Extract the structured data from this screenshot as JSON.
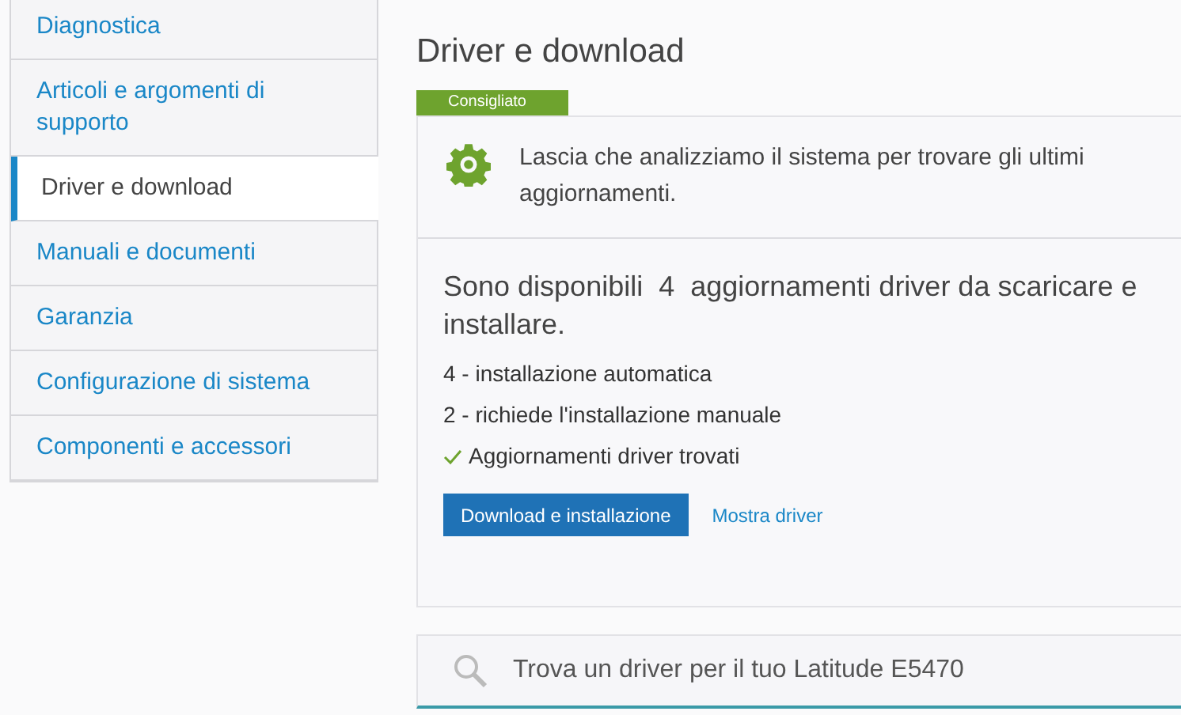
{
  "sidebar": {
    "items": [
      {
        "label": "Diagnostica",
        "selected": false
      },
      {
        "label": "Articoli e argomenti di supporto",
        "selected": false
      },
      {
        "label": "Driver e download",
        "selected": true
      },
      {
        "label": "Manuali e documenti",
        "selected": false
      },
      {
        "label": "Garanzia",
        "selected": false
      },
      {
        "label": "Configurazione di sistema",
        "selected": false
      },
      {
        "label": "Componenti e accessori",
        "selected": false
      }
    ]
  },
  "page_title": "Driver e download",
  "card": {
    "badge": "Consigliato",
    "intro": "Lascia che analizziamo il sistema per trovare gli ultimi aggiornamenti.",
    "heading": "Sono disponibili  4  aggiornamenti driver da scaricare e installare.",
    "details": [
      "4 - installazione automatica",
      "2 - richiede l'installazione manuale"
    ],
    "status": "Aggiornamenti driver trovati",
    "primary_button": "Download e installazione",
    "link": "Mostra driver"
  },
  "search": {
    "placeholder": "Trova un driver per il tuo Latitude E5470"
  }
}
